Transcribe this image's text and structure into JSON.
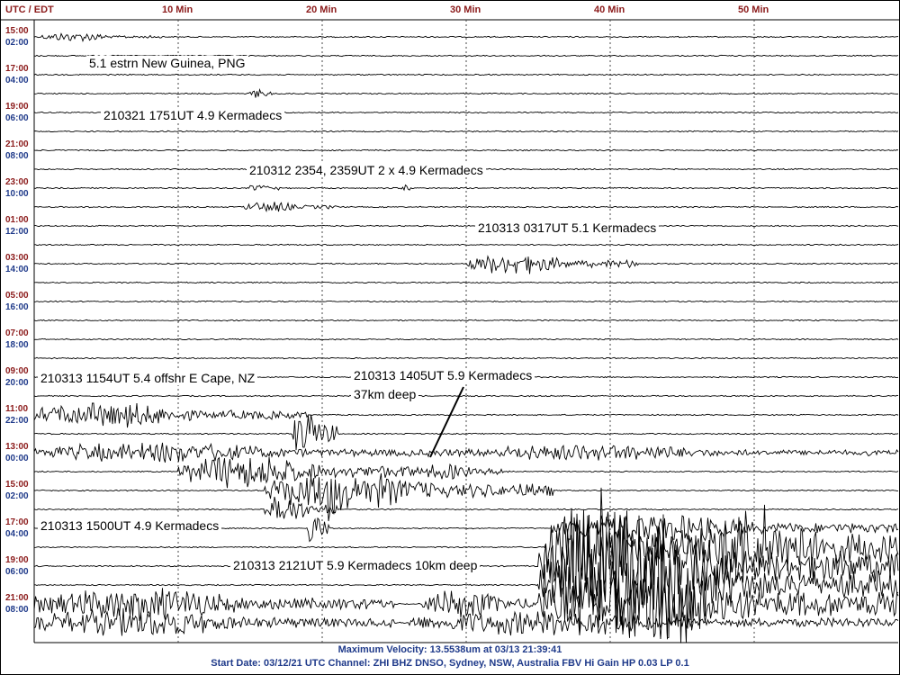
{
  "header": {
    "axis_label": "UTC / EDT",
    "minute_marks": [
      "10 Min",
      "20 Min",
      "30 Min",
      "40 Min",
      "50 Min"
    ]
  },
  "chart_data": {
    "type": "line",
    "title": "",
    "xlabel": "",
    "ylabel": "",
    "x_range_minutes": [
      0,
      60
    ],
    "rows_per_hour": 2,
    "row_count": 32,
    "time_labels_utc": [
      "15:00",
      "17:00",
      "19:00",
      "21:00",
      "23:00",
      "01:00",
      "03:00",
      "05:00",
      "07:00",
      "09:00",
      "11:00",
      "13:00",
      "15:00",
      "17:00",
      "19:00",
      "21:00"
    ],
    "time_labels_edt": [
      "02:00",
      "04:00",
      "06:00",
      "08:00",
      "10:00",
      "12:00",
      "14:00",
      "16:00",
      "18:00",
      "20:00",
      "22:00",
      "00:00",
      "02:00",
      "04:00",
      "06:00",
      "08:00"
    ],
    "grid": true,
    "annotations": [
      "5.1 estrn New Guinea, PNG",
      "210321 1751UT  4.9 Kermadecs",
      "210312 2354, 2359UT   2 x 4.9 Kermadecs",
      "210313 0317UT   5.1 Kermadecs",
      "210313 1154UT 5.4 offshr E Cape, NZ",
      "210313 1405UT  5.9 Kermadecs",
      "37km deep",
      "210313 1500UT  4.9 Kermadecs",
      "210313 2121UT  5.9 Kermadecs  10km deep"
    ]
  },
  "footer": {
    "line1": "Maximum Velocity: 13.5538um at 03/13 21:39:41",
    "line2": "Start Date: 03/12/21 UTC Channel: ZHI  BHZ  DNSO, Sydney, NSW, Australia  FBV Hi Gain HP 0.03  LP 0.1"
  }
}
